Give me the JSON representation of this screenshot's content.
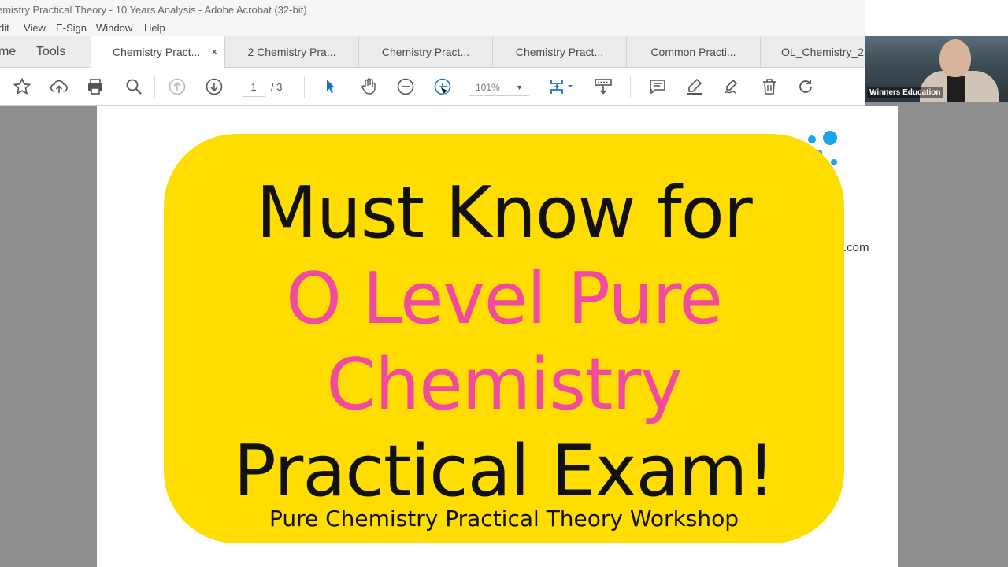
{
  "window": {
    "title": "emistry Practical Theory - 10 Years Analysis - Adobe Acrobat (32-bit)"
  },
  "menu": {
    "items": [
      "dit",
      "View",
      "E-Sign",
      "Window",
      "Help"
    ]
  },
  "tabs": {
    "home_label": "me",
    "tools_label": "Tools",
    "items": [
      {
        "label": "Chemistry Pract...",
        "close": "×"
      },
      {
        "label": "2 Chemistry Pra..."
      },
      {
        "label": "Chemistry Pract..."
      },
      {
        "label": "Chemistry Pract..."
      },
      {
        "label": "Common Practi..."
      },
      {
        "label": "OL_Chemistry_2"
      }
    ]
  },
  "toolbar": {
    "page_current": "1",
    "page_total": "/ 3",
    "zoom": "101%",
    "zoom_dropdown": "▼"
  },
  "webcam": {
    "label": "Winners Education"
  },
  "document": {
    "partial_text": ".com"
  },
  "banner": {
    "line1": "Must Know for",
    "line2": "O Level Pure",
    "line3": "Chemistry",
    "line4": "Practical Exam!",
    "subtitle": "Pure Chemistry Practical Theory Workshop",
    "colors": {
      "background": "#ffdd00",
      "accent": "#f04ba0",
      "text": "#111111"
    }
  }
}
